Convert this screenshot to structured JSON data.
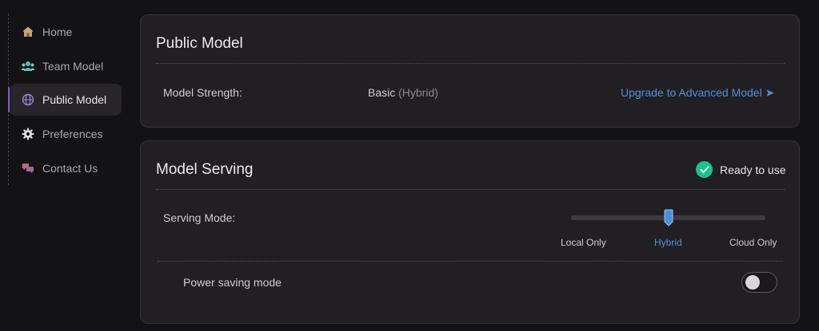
{
  "sidebar": {
    "items": [
      {
        "label": "Home",
        "icon": "home-icon",
        "active": false
      },
      {
        "label": "Team Model",
        "icon": "team-icon",
        "active": false
      },
      {
        "label": "Public Model",
        "icon": "globe-icon",
        "active": true
      },
      {
        "label": "Preferences",
        "icon": "gear-icon",
        "active": false
      },
      {
        "label": "Contact Us",
        "icon": "chat-bubbles-icon",
        "active": false
      }
    ]
  },
  "public_model": {
    "title": "Public Model",
    "strength_label": "Model Strength:",
    "strength_value": "Basic",
    "strength_qualifier": "(Hybrid)",
    "upgrade_link": "Upgrade to Advanced Model ➤"
  },
  "model_serving": {
    "title": "Model Serving",
    "status": "Ready to use",
    "status_color": "#1ec28b",
    "serving_mode_label": "Serving Mode:",
    "mode_options": [
      "Local Only",
      "Hybrid",
      "Cloud Only"
    ],
    "selected_mode": "Hybrid",
    "power_saving_label": "Power saving mode",
    "power_saving_on": false
  },
  "colors": {
    "accent": "#4c8fd8",
    "background": "#131214",
    "card": "#221f24"
  }
}
